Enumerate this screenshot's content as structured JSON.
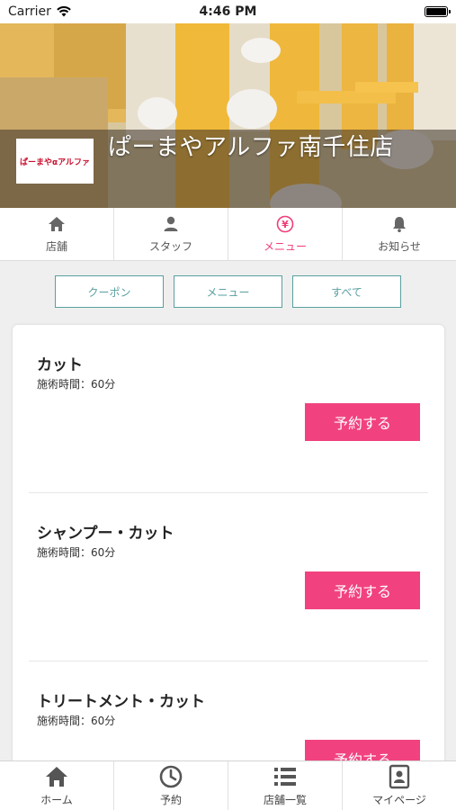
{
  "status_bar": {
    "carrier": "Carrier",
    "time": "4:46 PM"
  },
  "header": {
    "shop_name": "ぱーまやアルファ南千住店",
    "logo_text": "ぱーまやαアルファ"
  },
  "top_tabs": [
    {
      "label": "店舗",
      "icon": "home-icon",
      "active": false
    },
    {
      "label": "スタッフ",
      "icon": "person-icon",
      "active": false
    },
    {
      "label": "メニュー",
      "icon": "yen-icon",
      "active": true
    },
    {
      "label": "お知らせ",
      "icon": "bell-icon",
      "active": false
    }
  ],
  "filters": [
    "クーポン",
    "メニュー",
    "すべて"
  ],
  "menu_items": [
    {
      "name": "カット",
      "duration": "施術時間：60分",
      "book_label": "予約する"
    },
    {
      "name": "シャンプー・カット",
      "duration": "施術時間：60分",
      "book_label": "予約する"
    },
    {
      "name": "トリートメント・カット",
      "duration": "施術時間：60分",
      "book_label": "予約する"
    }
  ],
  "bottom_tabs": [
    {
      "label": "ホーム",
      "icon": "home-icon"
    },
    {
      "label": "予約",
      "icon": "clock-icon"
    },
    {
      "label": "店舗一覧",
      "icon": "list-icon"
    },
    {
      "label": "マイページ",
      "icon": "id-card-icon"
    }
  ],
  "colors": {
    "accent_pink": "#f1427f",
    "filter_teal": "#5a9fa0",
    "background": "#efefef"
  }
}
